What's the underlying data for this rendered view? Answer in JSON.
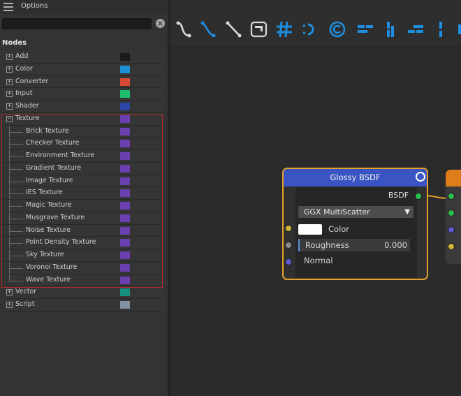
{
  "panel": {
    "title": "Options",
    "search_placeholder": "",
    "search_value": "",
    "nodes_header": "Nodes"
  },
  "tree": {
    "categories": [
      {
        "label": "Add",
        "color": "#1a1a1a",
        "expanded": false
      },
      {
        "label": "Color",
        "color": "#1f8fd6",
        "expanded": false
      },
      {
        "label": "Converter",
        "color": "#d64a36",
        "expanded": false
      },
      {
        "label": "Input",
        "color": "#1dbd6d",
        "expanded": false
      },
      {
        "label": "Shader",
        "color": "#2a47a8",
        "expanded": false
      },
      {
        "label": "Texture",
        "color": "#6a3fb0",
        "expanded": true,
        "children": [
          "Brick Texture",
          "Checker Texture",
          "Environment Texture",
          "Gradient Texture",
          "Image Texture",
          "IES Texture",
          "Magic Texture",
          "Musgrave Texture",
          "Noise Texture",
          "Point Density Texture",
          "Sky Texture",
          "Voronoi Texture",
          "Wave Texture"
        ]
      },
      {
        "label": "Vector",
        "color": "#178f7f",
        "expanded": false
      },
      {
        "label": "Script",
        "color": "#8393a2",
        "expanded": false
      }
    ]
  },
  "toolbar": {
    "icons": [
      "curve-wire-icon",
      "curve-wire-blue-icon",
      "straight-wire-icon",
      "frame-icon",
      "grid-snap-icon",
      "reroute-icon",
      "auto-layout-icon",
      "align-left-icon",
      "align-vertical-icon",
      "align-right-icon",
      "distribute-icon",
      "align-more-icon"
    ],
    "accent": "#1e8fe0"
  },
  "node": {
    "title": "Glossy BSDF",
    "output_label": "BSDF",
    "distribution": "GGX MultiScatter",
    "color_label": "Color",
    "color_value": "#ffffff",
    "roughness_label": "Roughness",
    "roughness_value": "0.000",
    "normal_label": "Normal",
    "header_color": "#3a55c3",
    "border_color": "#e6a22a"
  },
  "node2": {
    "header_color": "#df7d1a"
  }
}
